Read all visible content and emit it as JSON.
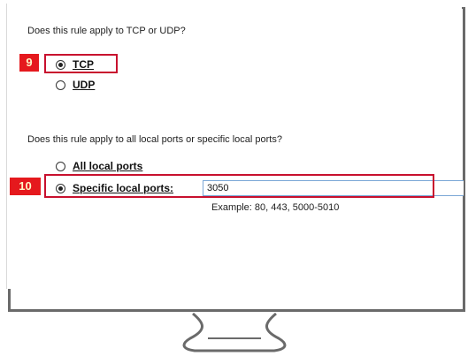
{
  "protocol_question": "Does this rule apply to TCP or UDP?",
  "protocol_options": [
    {
      "label": "TCP",
      "selected": true
    },
    {
      "label": "UDP",
      "selected": false
    }
  ],
  "ports_question": "Does this rule apply to all local ports or specific local ports?",
  "port_options": [
    {
      "label": "All local ports",
      "selected": false
    },
    {
      "label": "Specific local ports:",
      "selected": true
    }
  ],
  "port_input_value": "3050",
  "example_text": "Example: 80, 443, 5000-5010",
  "step_badges": [
    "9",
    "10"
  ],
  "colors": {
    "highlight": "#c8102e",
    "badge_bg": "#e5191d",
    "badge_text": "#fff8c8",
    "frame": "#6a6a6a"
  }
}
